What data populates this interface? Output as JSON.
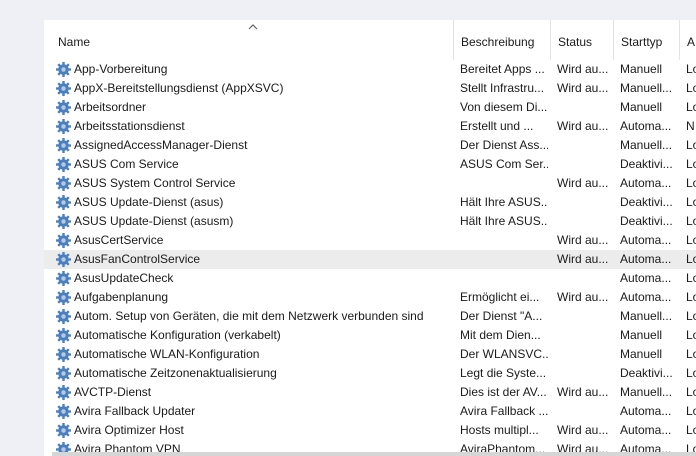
{
  "columns": {
    "name": "Name",
    "description": "Beschreibung",
    "status": "Status",
    "starttype": "Starttyp",
    "logon": "A"
  },
  "colors": {
    "gear": "#4a7fc1",
    "gear_light": "#b8c9dc",
    "highlight": "#ececec"
  },
  "icons": {
    "sort": "chevron-up-icon",
    "service": "gear-icon"
  },
  "services": [
    {
      "name": "App-Vorbereitung",
      "description": "Bereitet Apps ...",
      "status": "Wird au...",
      "starttype": "Manuell",
      "logon": "Lo"
    },
    {
      "name": "AppX-Bereitstellungsdienst (AppXSVC)",
      "description": "Stellt Infrastru...",
      "status": "Wird au...",
      "starttype": "Manuell...",
      "logon": "Lo"
    },
    {
      "name": "Arbeitsordner",
      "description": "Von diesem Di...",
      "status": "",
      "starttype": "Manuell",
      "logon": "Lo"
    },
    {
      "name": "Arbeitsstationsdienst",
      "description": "Erstellt und ...",
      "status": "Wird au...",
      "starttype": "Automa...",
      "logon": "N"
    },
    {
      "name": "AssignedAccessManager-Dienst",
      "description": "Der Dienst Ass...",
      "status": "",
      "starttype": "Manuell...",
      "logon": "Lo"
    },
    {
      "name": "ASUS Com Service",
      "description": "ASUS Com Ser...",
      "status": "",
      "starttype": "Deaktivi...",
      "logon": "Lo"
    },
    {
      "name": "ASUS System Control Service",
      "description": "",
      "status": "Wird au...",
      "starttype": "Automa...",
      "logon": "Lo"
    },
    {
      "name": "ASUS Update-Dienst (asus)",
      "description": "Hält Ihre ASUS...",
      "status": "",
      "starttype": "Deaktivi...",
      "logon": "Lo"
    },
    {
      "name": "ASUS Update-Dienst (asusm)",
      "description": "Hält Ihre ASUS...",
      "status": "",
      "starttype": "Deaktivi...",
      "logon": "Lo"
    },
    {
      "name": "AsusCertService",
      "description": "",
      "status": "Wird au...",
      "starttype": "Automa...",
      "logon": "Lo"
    },
    {
      "name": "AsusFanControlService",
      "description": "",
      "status": "Wird au...",
      "starttype": "Automa...",
      "logon": "Lo",
      "selected": true
    },
    {
      "name": "AsusUpdateCheck",
      "description": "",
      "status": "",
      "starttype": "Automa...",
      "logon": "Lo"
    },
    {
      "name": "Aufgabenplanung",
      "description": "Ermöglicht ei...",
      "status": "Wird au...",
      "starttype": "Automa...",
      "logon": "Lo"
    },
    {
      "name": "Autom. Setup von Geräten, die mit dem Netzwerk verbunden sind",
      "description": "Der Dienst \"A...",
      "status": "",
      "starttype": "Manuell...",
      "logon": "Lo"
    },
    {
      "name": "Automatische Konfiguration (verkabelt)",
      "description": "Mit dem Dien...",
      "status": "",
      "starttype": "Manuell",
      "logon": "Lo"
    },
    {
      "name": "Automatische WLAN-Konfiguration",
      "description": "Der WLANSVC...",
      "status": "",
      "starttype": "Manuell",
      "logon": "Lo"
    },
    {
      "name": "Automatische Zeitzonenaktualisierung",
      "description": "Legt die Syste...",
      "status": "",
      "starttype": "Deaktivi...",
      "logon": "Lo"
    },
    {
      "name": "AVCTP-Dienst",
      "description": "Dies ist der AV...",
      "status": "Wird au...",
      "starttype": "Manuell...",
      "logon": "Lo"
    },
    {
      "name": "Avira Fallback Updater",
      "description": "Avira Fallback ...",
      "status": "",
      "starttype": "Automa...",
      "logon": "Lo"
    },
    {
      "name": "Avira Optimizer Host",
      "description": "Hosts multipl...",
      "status": "Wird au...",
      "starttype": "Automa...",
      "logon": "Lo"
    },
    {
      "name": "Avira Phantom VPN",
      "description": "AviraPhantom...",
      "status": "Wird au...",
      "starttype": "Automa...",
      "logon": "Lo"
    }
  ]
}
